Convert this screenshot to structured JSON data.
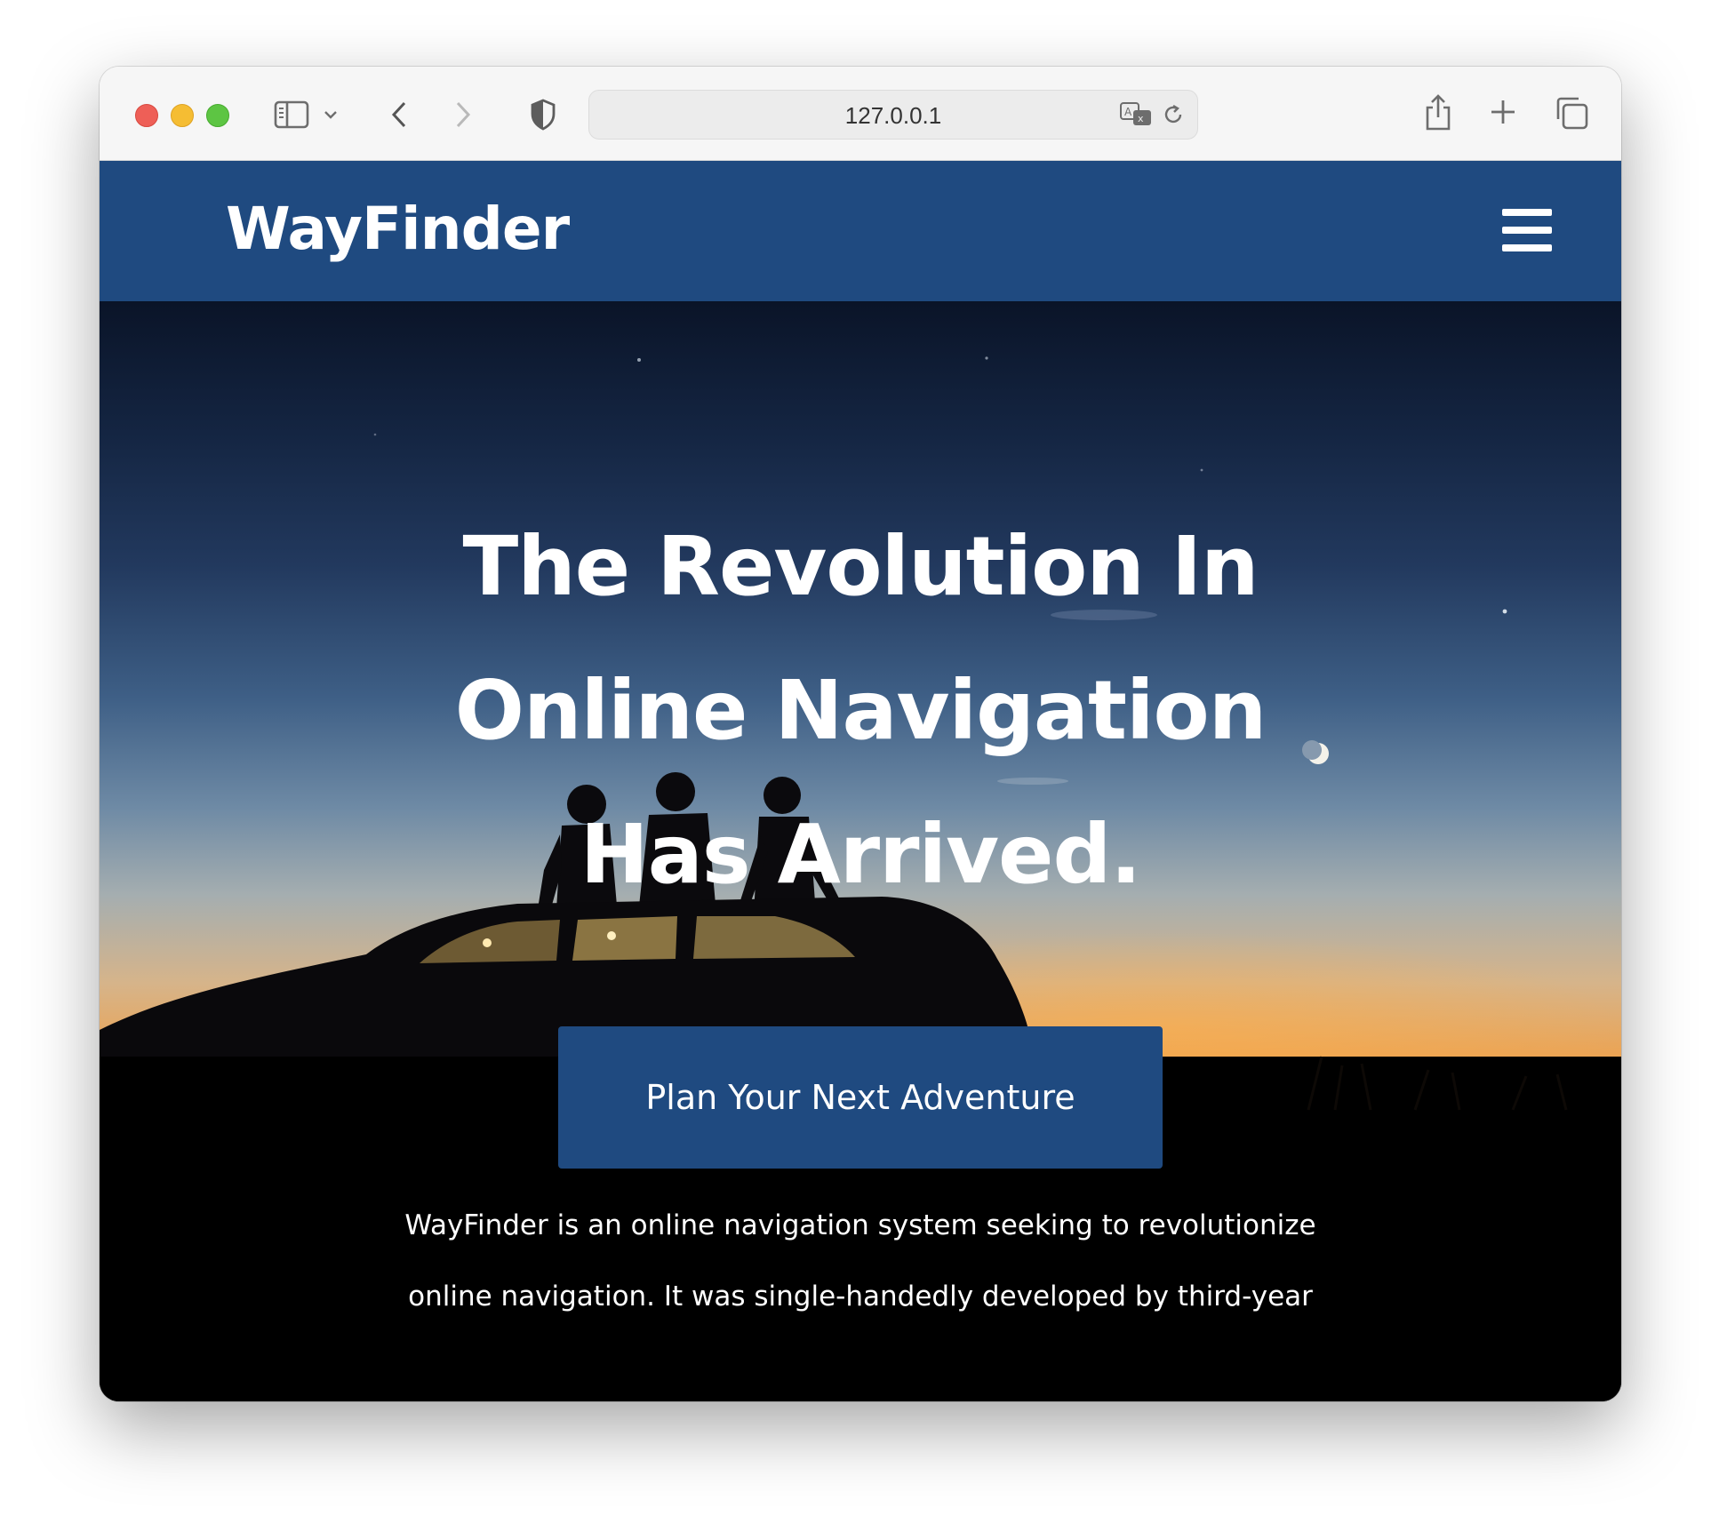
{
  "browser": {
    "url": "127.0.0.1"
  },
  "site": {
    "brand": "WayFinder",
    "hero": {
      "title": "The Revolution In Online Navigation Has Arrived.",
      "cta_label": "Plan Your Next Adventure",
      "intro": "WayFinder is an online navigation system seeking to revolutionize online navigation. It was single-handedly developed by third-year"
    }
  },
  "icons": {
    "sidebar": "sidebar-icon",
    "back": "chevron-left-icon",
    "forward": "chevron-right-icon",
    "privacy": "shield-icon",
    "translate": "translate-icon",
    "reload": "reload-icon",
    "share": "share-icon",
    "new_tab": "plus-icon",
    "tabs": "tabs-overview-icon",
    "menu": "hamburger-menu-icon"
  },
  "colors": {
    "brand_blue": "#1f4a80",
    "text_white": "#ffffff"
  }
}
